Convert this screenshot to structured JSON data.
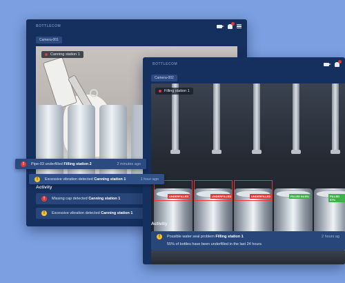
{
  "panel_a": {
    "logo": "BOTTLECOM",
    "camera": "Camera-001",
    "station": "Canning station 1",
    "activity_title": "Activity",
    "alerts": [
      {
        "severity": "error",
        "text": "Missing cap detected",
        "station": "Canning station 1"
      },
      {
        "severity": "warning",
        "text": "Excessive vibration detected",
        "station": "Canning station 1"
      }
    ]
  },
  "panel_b": {
    "logo": "BOTTLECOM",
    "camera": "Camera-002",
    "station": "Filling station 1",
    "tags": [
      "UNDERFILLED",
      "UNDERFILLED",
      "UNDERFILLED",
      "FILLED 94.5%",
      "FILLED 97%"
    ],
    "activity_title": "Activity",
    "alert": {
      "severity": "warning",
      "text": "Possible water seal problem",
      "station": "Filling station 1",
      "time": "2 hours ag",
      "detail": "55% of bottles have been underfilled in the last 24 hours"
    }
  },
  "toasts": [
    {
      "severity": "error",
      "text": "Pipe-03 underfilled",
      "station": "Filling station 2",
      "time": "2 minutes ago"
    },
    {
      "severity": "warning",
      "text": "Excessive vibration detected",
      "station": "Canning station 1",
      "time": "1 hour ago"
    }
  ],
  "icons": {
    "camera": "video-camera-icon",
    "bell": "notification-bell-icon",
    "menu": "hamburger-menu-icon",
    "error": "error-alert-icon",
    "warning": "warning-alert-icon"
  },
  "colors": {
    "error": "#e53935",
    "warning": "#f2c230",
    "ok": "#3fb04a",
    "panel": "#15305f"
  }
}
